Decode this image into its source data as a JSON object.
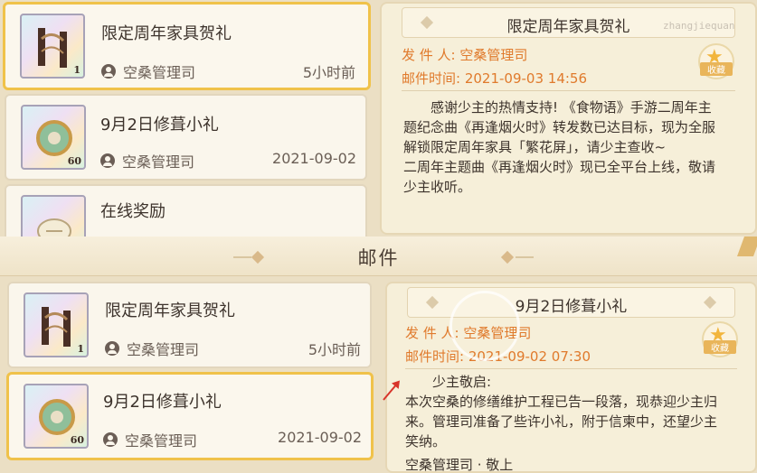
{
  "watermark": "zhangjiequan",
  "header": {
    "title": "邮件"
  },
  "mails": [
    {
      "title": "限定周年家具贺礼",
      "sender": "空桑管理司",
      "time": "5小时前",
      "qty": "1"
    },
    {
      "title": "9月2日修葺小礼",
      "sender": "空桑管理司",
      "time": "2021-09-02",
      "qty": "60"
    },
    {
      "title": "在线奖励"
    }
  ],
  "top_detail": {
    "title": "限定周年家具贺礼",
    "sender_label": "发 件 人:",
    "sender": "空桑管理司",
    "time_label": "邮件时间:",
    "time": "2021-09-03 14:56",
    "collect": "收藏",
    "body": [
      "感谢少主的热情支持! 《食物语》手游二周年主",
      "题纪念曲《再逢烟火时》转发数已达目标，现为全服",
      "解锁限定周年家具「繁花屏」，请少主查收~",
      "二周年主题曲《再逢烟火时》现已全平台上线，敬请",
      "少主收听。"
    ]
  },
  "bottom_detail": {
    "title": "9月2日修葺小礼",
    "sender_label": "发 件 人:",
    "sender": "空桑管理司",
    "time_label": "邮件时间:",
    "time": "2021-09-02 07:30",
    "collect": "收藏",
    "greeting": "少主敬启:",
    "body": [
      "本次空桑的修缮维护工程已告一段落，现恭迎少主归",
      "来。管理司准备了些许小礼，附于信柬中，还望少主",
      "笑纳。"
    ],
    "signature": "空桑管理司 · 敬上"
  },
  "colors": {
    "accent": "#e07a2c",
    "selected_border": "#f0c24a",
    "arrow": "#d8342a"
  },
  "icons": [
    "user-icon",
    "star-icon",
    "sparkle-icon",
    "arrow-icon"
  ]
}
